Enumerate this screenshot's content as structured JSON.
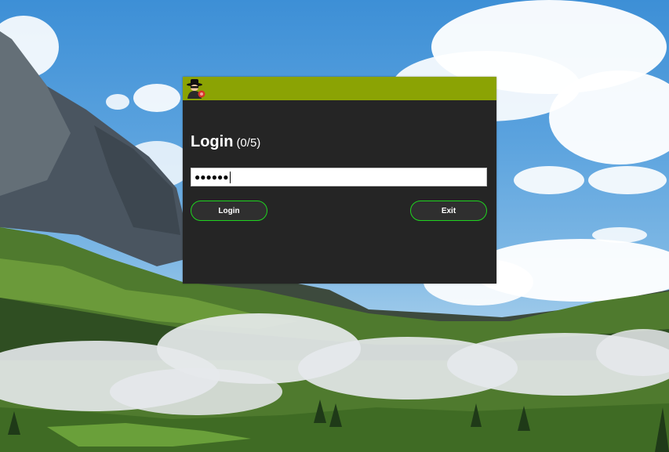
{
  "login_dialog": {
    "heading": "Login",
    "attempts": "(0/5)",
    "password_masked": "●●●●●●",
    "login_label": "Login",
    "exit_label": "Exit",
    "app_icon": "spy-agent-icon"
  },
  "colors": {
    "title_bar": "#8ba304",
    "window_bg": "#252525",
    "button_border": "#1fd41f"
  },
  "wallpaper": {
    "subject": "mountain-valley-clouds"
  }
}
